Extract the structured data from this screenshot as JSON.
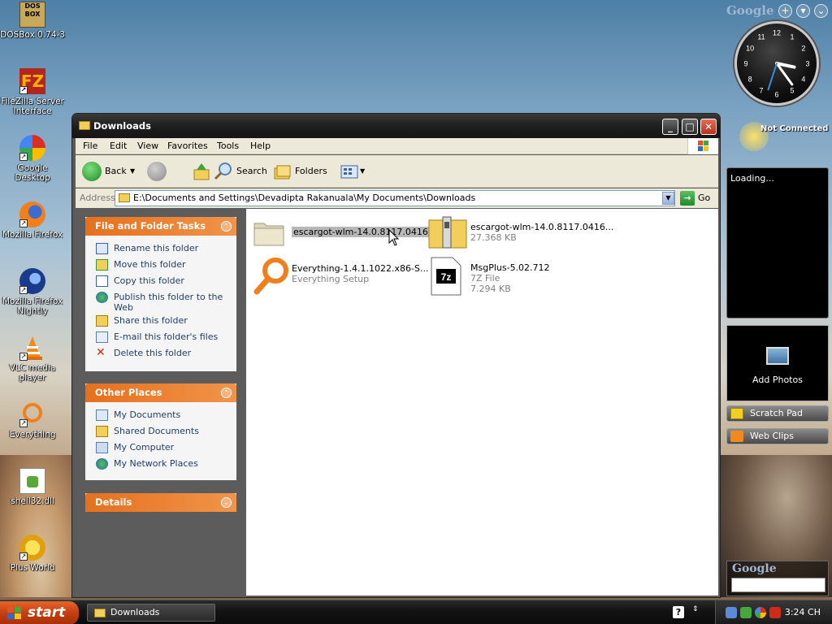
{
  "desktop": {
    "icons": [
      {
        "label": "DOSBox 0.74-3"
      },
      {
        "label": "FileZilla Server Interface"
      },
      {
        "label": "Google Desktop"
      },
      {
        "label": "Mozilla Firefox"
      },
      {
        "label": "Mozilla Firefox Nightly"
      },
      {
        "label": "VLC media player"
      },
      {
        "label": "Everything"
      },
      {
        "label": "shell32.dll"
      },
      {
        "label": "Plus World"
      }
    ]
  },
  "gadgets": {
    "google_label": "Google",
    "add_button": "+",
    "menu_button": "▾",
    "not_connected": "Not Connected",
    "loading": "Loading...",
    "add_photos": "Add Photos",
    "scratch_pad": "Scratch Pad",
    "web_clips": "Web Clips",
    "search_google_label": "Google",
    "clock": {
      "hour": 3,
      "minute": 24,
      "second": 33
    }
  },
  "window": {
    "title": "Downloads",
    "menu": [
      "File",
      "Edit",
      "View",
      "Favorites",
      "Tools",
      "Help"
    ],
    "toolbar": {
      "back": "Back",
      "search": "Search",
      "folders": "Folders"
    },
    "address": {
      "label": "Address",
      "path": "E:\\Documents and Settings\\Devadipta Rakanuala\\My Documents\\Downloads",
      "go": "Go"
    },
    "file_tasks": {
      "title": "File and Folder Tasks",
      "items": [
        "Rename this folder",
        "Move this folder",
        "Copy this folder",
        "Publish this folder to the Web",
        "Share this folder",
        "E-mail this folder's files",
        "Delete this folder"
      ]
    },
    "other_places": {
      "title": "Other Places",
      "items": [
        "My Documents",
        "Shared Documents",
        "My Computer",
        "My Network Places"
      ]
    },
    "details": {
      "title": "Details"
    },
    "files": [
      {
        "name": "escargot-wlm-14.0.8117.0416...",
        "sub1": "",
        "sub2": ""
      },
      {
        "name": "escargot-wlm-14.0.8117.0416...",
        "sub1": "27.368 KB",
        "sub2": ""
      },
      {
        "name": "Everything-1.4.1.1022.x86-S...",
        "sub1": "Everything Setup",
        "sub2": ""
      },
      {
        "name": "MsgPlus-5.02.712",
        "sub1": "7Z File",
        "sub2": "7.294 KB"
      }
    ]
  },
  "taskbar": {
    "start": "start",
    "active_task": "Downloads",
    "time": "3:24 CH",
    "help": "?"
  },
  "colors": {
    "accent_orange": "#e6701e",
    "title_dark": "#1f1f1f",
    "link_blue": "#1f3f6f"
  }
}
